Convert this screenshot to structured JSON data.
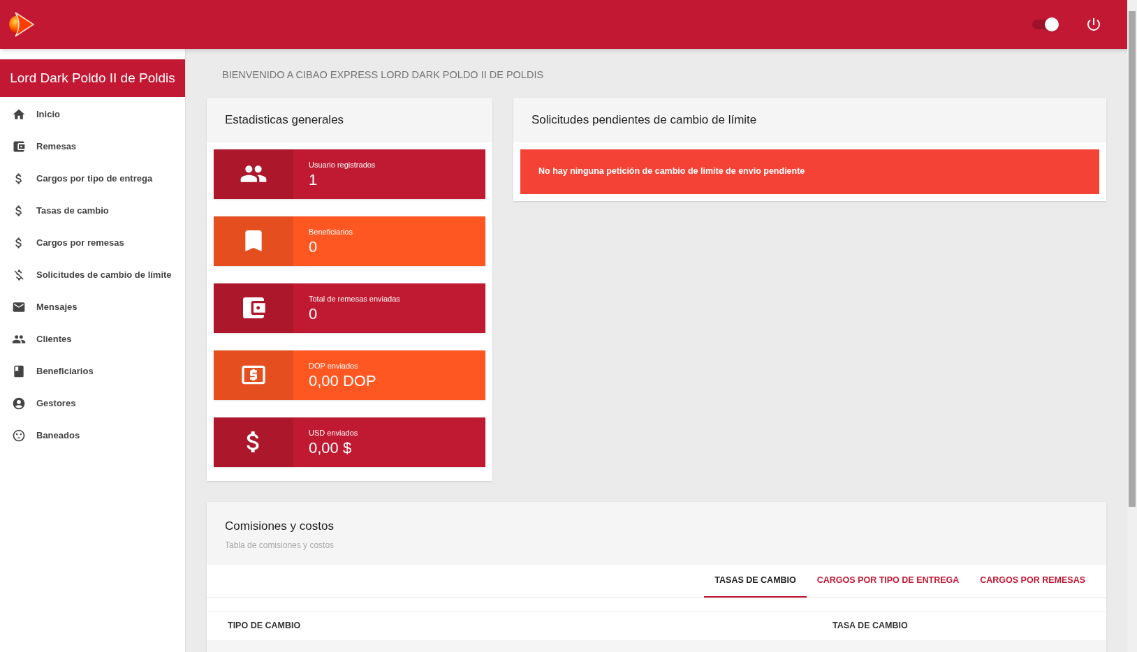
{
  "header": {
    "toggle": {
      "on": true
    }
  },
  "sidebar": {
    "user_name": "Lord Dark Poldo II de Poldis",
    "items": [
      {
        "label": "Inicio"
      },
      {
        "label": "Remesas"
      },
      {
        "label": "Cargos por tipo de entrega"
      },
      {
        "label": "Tasas de cambio"
      },
      {
        "label": "Cargos por remesas"
      },
      {
        "label": "Solicitudes de cambio de límite"
      },
      {
        "label": "Mensajes"
      },
      {
        "label": "Clientes"
      },
      {
        "label": "Beneficiarios"
      },
      {
        "label": "Gestores"
      },
      {
        "label": "Baneados"
      }
    ]
  },
  "welcome": "BIENVENIDO A CIBAO EXPRESS LORD DARK POLDO II DE POLDIS",
  "stats": {
    "title": "Estadisticas generales",
    "cards": [
      {
        "label": "Usuario registrados",
        "value": "1",
        "color": "#c01a32"
      },
      {
        "label": "Beneficiarios",
        "value": "0",
        "color": "#ff5722"
      },
      {
        "label": "Total de remesas enviadas",
        "value": "0",
        "color": "#c01a32"
      },
      {
        "label": "DOP enviados",
        "value": "0,00 DOP",
        "color": "#ff5722"
      },
      {
        "label": "USD enviados",
        "value": "0,00 $",
        "color": "#c01a32"
      }
    ]
  },
  "pending": {
    "title": "Solicitudes pendientes de cambio de límite",
    "message": "No hay ninguna petición de cambio de limite de envio pendiente"
  },
  "commissions": {
    "title": "Comisiones y costos",
    "subtitle": "Tabla de comisiones y costos",
    "tabs": [
      {
        "label": "TASAS DE CAMBIO",
        "selected": true
      },
      {
        "label": "CARGOS POR TIPO DE ENTREGA",
        "selected": false
      },
      {
        "label": "CARGOS POR REMESAS",
        "selected": false
      }
    ],
    "columns": [
      "TIPO DE CAMBIO",
      "TASA DE CAMBIO"
    ]
  }
}
